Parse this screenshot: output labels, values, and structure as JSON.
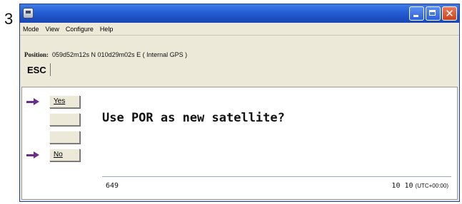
{
  "step_number": "3",
  "window": {
    "menu": [
      "Mode",
      "View",
      "Configure",
      "Help"
    ],
    "position_label": "Position:",
    "position_value": "059d52m12s N 010d29m02s E ( Internal GPS )",
    "esc_label": "ESC",
    "softkeys": [
      {
        "label": "Yes",
        "selected": true
      },
      {
        "label": "",
        "selected": false
      },
      {
        "label": "",
        "selected": false
      },
      {
        "label": "No",
        "selected": true
      }
    ],
    "question": "Use POR as new satellite?",
    "status": {
      "counter": "649",
      "time": "10 10",
      "timezone": "(UTC+00:00)"
    }
  },
  "colors": {
    "titlebar": "#2a63d8",
    "arrow": "#6b2d8c",
    "close_button": "#c9441b"
  }
}
